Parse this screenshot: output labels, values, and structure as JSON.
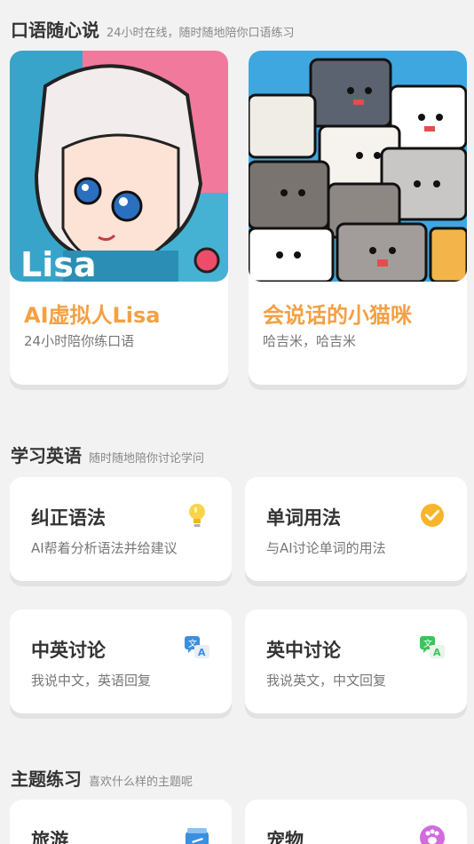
{
  "speak_section": {
    "title": "口语随心说",
    "subtitle": "24小时在线，随时随地陪你口语练习",
    "cards": [
      {
        "badge": "Lisa",
        "title": "AI虚拟人Lisa",
        "subtitle": "24小时陪你练口语"
      },
      {
        "title": "会说话的小猫咪",
        "subtitle": "哈吉米，哈吉米"
      }
    ]
  },
  "study_section": {
    "title": "学习英语",
    "subtitle": "随时随地陪你讨论学问",
    "tiles": [
      {
        "title": "纠正语法",
        "subtitle": "AI帮着分析语法并给建议",
        "icon": "lightbulb-icon"
      },
      {
        "title": "单词用法",
        "subtitle": "与AI讨论单词的用法",
        "icon": "check-circle-icon"
      },
      {
        "title": "中英讨论",
        "subtitle": "我说中文，英语回复",
        "icon": "translate-icon"
      },
      {
        "title": "英中讨论",
        "subtitle": "我说英文，中文回复",
        "icon": "translate-icon"
      }
    ]
  },
  "theme_section": {
    "title": "主题练习",
    "subtitle": "喜欢什么样的主题呢",
    "tiles": [
      {
        "title": "旅游",
        "icon": "airplane-icon"
      },
      {
        "title": "宠物",
        "icon": "paw-icon"
      }
    ]
  },
  "colors": {
    "accent_orange": "#f5a043",
    "check_yellow": "#f7b52c",
    "translate_blue": "#3a8fe0",
    "translate_green": "#3cc45a",
    "paw_purple": "#d36ae0"
  }
}
